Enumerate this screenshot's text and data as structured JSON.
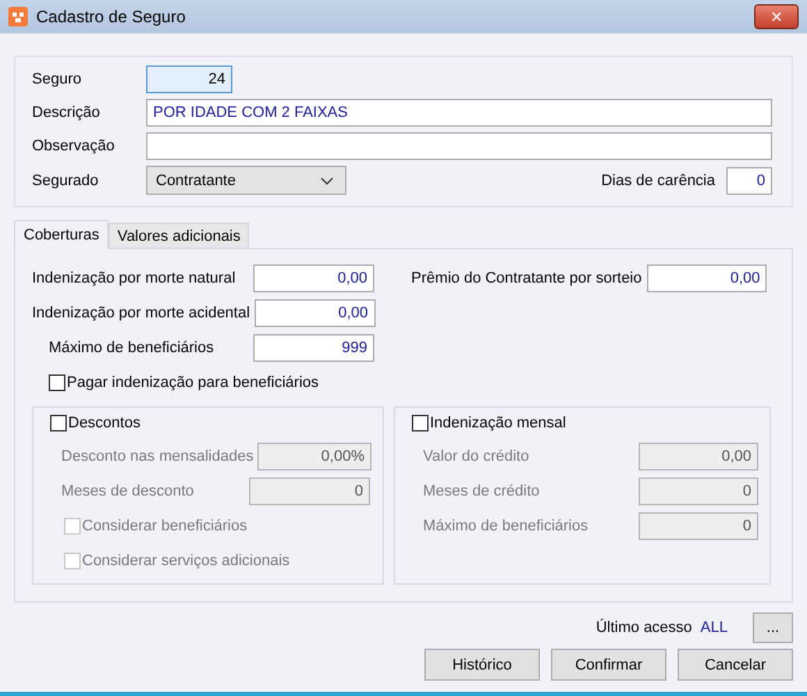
{
  "window": {
    "title": "Cadastro de Seguro",
    "close": "✕"
  },
  "header": {
    "seguro": {
      "label": "Seguro",
      "value": "24",
      "focused": true
    },
    "descricao": {
      "label": "Descrição",
      "value": "POR IDADE COM 2 FAIXAS"
    },
    "observacao": {
      "label": "Observação"
    },
    "segurado": {
      "label": "Segurado",
      "value": "Contratante"
    },
    "dias_carencia": {
      "label": "Dias de carência",
      "value": "0"
    }
  },
  "tabs": [
    {
      "label": "Coberturas",
      "selected": true
    },
    {
      "label": "Valores adicionais",
      "selected": false
    }
  ],
  "coberturas": {
    "left": [
      {
        "label": "Indenização por morte natural",
        "value": "0,00",
        "indent": false
      },
      {
        "label": "Indenização por morte acidental",
        "value": "0,00",
        "indent": false
      },
      {
        "label": "Máximo de beneficiários",
        "value": "999",
        "indent": true
      }
    ],
    "premio": {
      "label": "Prêmio do Contratante por sorteio",
      "value": "0,00"
    },
    "pagar": {
      "label": "Pagar indenização para beneficiários",
      "checked": false
    },
    "groups": [
      {
        "title": "Descontos",
        "checked": false,
        "items": [
          {
            "kind": "field",
            "label": "Desconto nas mensalidades",
            "value": "0,00%",
            "disabled": true
          },
          {
            "kind": "field",
            "label": "Meses de desconto",
            "value": "0",
            "disabled": true
          },
          {
            "kind": "checkbox",
            "label": "Considerar beneficiários",
            "checked": false,
            "disabled": true
          },
          {
            "kind": "checkbox",
            "label": "Considerar serviços adicionais",
            "checked": false,
            "disabled": true
          }
        ]
      },
      {
        "title": "Indenização mensal",
        "checked": false,
        "items": [
          {
            "kind": "field",
            "label": "Valor do crédito",
            "value": "0,00",
            "disabled": true
          },
          {
            "kind": "field",
            "label": "Meses de crédito",
            "value": "0",
            "disabled": true
          },
          {
            "kind": "field",
            "label": "Máximo de beneficiários",
            "value": "0",
            "disabled": true
          }
        ]
      }
    ]
  },
  "footer": {
    "ultimo_label": "Último acesso",
    "ultimo_value": "ALL",
    "more": "...",
    "buttons": [
      "Histórico",
      "Confirmar",
      "Cancelar"
    ]
  }
}
